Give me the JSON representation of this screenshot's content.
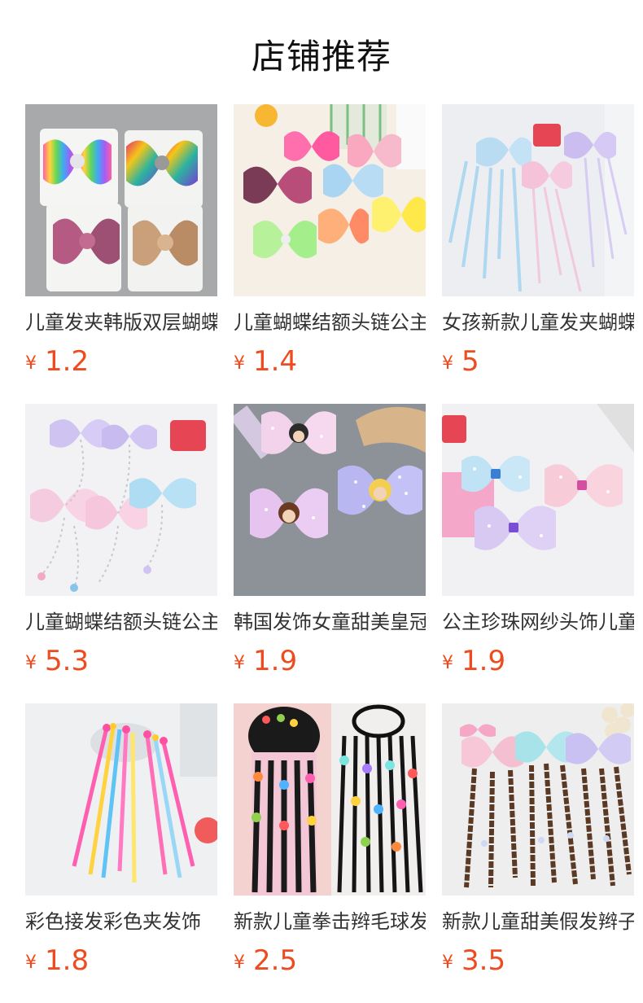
{
  "section": {
    "title": "店铺推荐"
  },
  "currency_symbol": "¥",
  "products": [
    {
      "name": "儿童发夹韩版双层蝴蝶结",
      "price": "1.2",
      "image": "sequin-bows-on-cards"
    },
    {
      "name": "儿童蝴蝶结额头链公主",
      "price": "1.4",
      "image": "colorful-sequin-bows"
    },
    {
      "name": "女孩新款儿童发夹蝴蝶结",
      "price": "5",
      "image": "pastel-ribbon-bows"
    },
    {
      "name": "儿童蝴蝶结额头链公主",
      "price": "5.3",
      "image": "bow-forehead-chains"
    },
    {
      "name": "韩国发饰女童甜美皇冠",
      "price": "1.9",
      "image": "princess-tulle-bows"
    },
    {
      "name": "公主珍珠网纱头饰儿童",
      "price": "1.9",
      "image": "pearl-mesh-bows"
    },
    {
      "name": "彩色接发彩色夹发饰",
      "price": "1.8",
      "image": "colorful-hair-extension-clips"
    },
    {
      "name": "新款儿童拳击辫毛球发绳",
      "price": "2.5",
      "image": "pompom-braid-hair-ties"
    },
    {
      "name": "新款儿童甜美假发辫子",
      "price": "3.5",
      "image": "wig-braid-bow-clips"
    }
  ]
}
